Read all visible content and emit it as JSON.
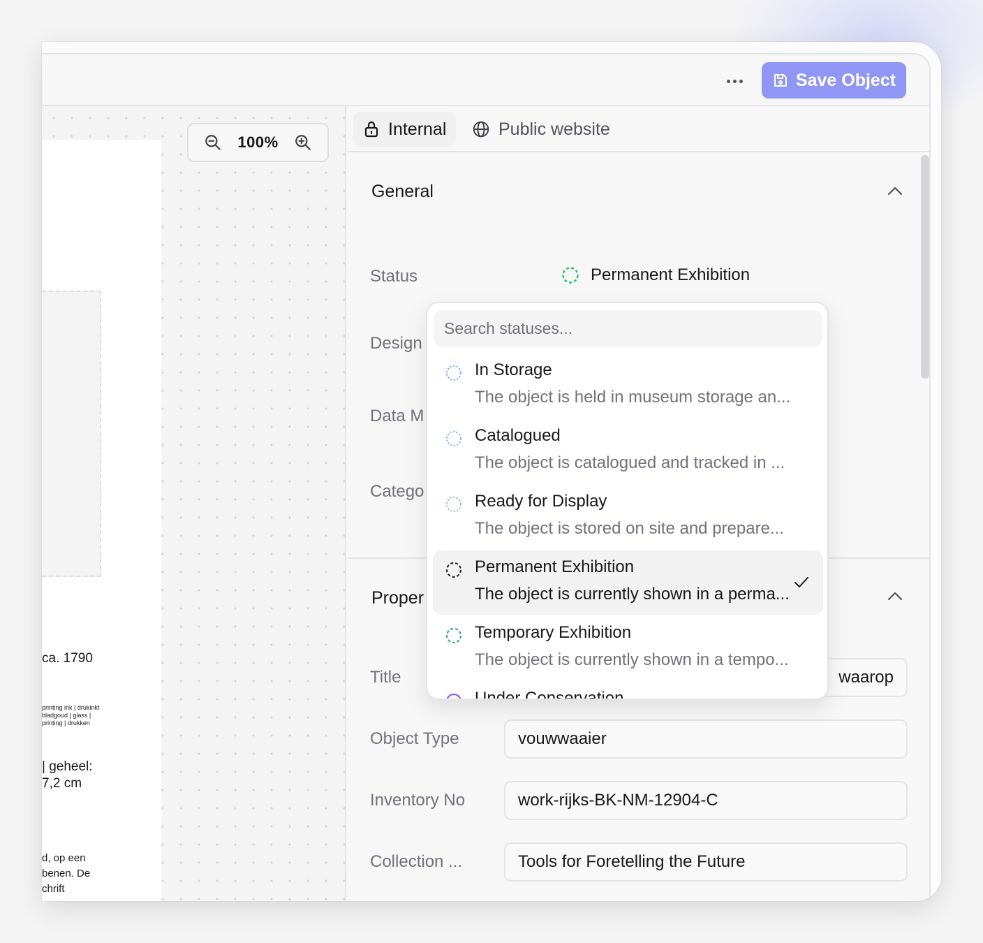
{
  "header": {
    "more_label": "···",
    "save_label": "Save Object",
    "save_color": "#8f96f4"
  },
  "canvas": {
    "zoom_level": "100%",
    "paper_date": "ca. 1790",
    "paper_materials": "printing ink | drukinkt\nbladgoud | glass |\nprinting | drukken",
    "paper_dims": "| geheel:\n7,2 cm",
    "paper_desc": "d, op een\nbenen. De\nchrift"
  },
  "tabs": [
    {
      "label": "Internal",
      "icon": "lock-icon"
    },
    {
      "label": "Public website",
      "icon": "globe-icon"
    }
  ],
  "general": {
    "title": "General",
    "status_label": "Status",
    "status_value": "Permanent Exhibition",
    "design_label": "Design",
    "data_label": "Data M",
    "category_label": "Catego"
  },
  "properties": {
    "title": "Proper",
    "fields": [
      {
        "label": "Title",
        "value": "waarop"
      },
      {
        "label": "Object Type",
        "value": "vouwwaaier"
      },
      {
        "label": "Inventory No",
        "value": "work-rijks-BK-NM-12904-C"
      },
      {
        "label": "Collection ...",
        "value": "Tools for Foretelling the Future"
      }
    ]
  },
  "dropdown": {
    "search_placeholder": "Search statuses...",
    "options": [
      {
        "title": "In Storage",
        "desc": "The object is held in museum storage an...",
        "color": "#60a5fa"
      },
      {
        "title": "Catalogued",
        "desc": "The object is catalogued and tracked in ...",
        "color": "#67b6e8"
      },
      {
        "title": "Ready for Display",
        "desc": "The object is stored on site and prepare...",
        "color": "#7cc9a0"
      },
      {
        "title": "Permanent Exhibition",
        "desc": "The object is currently shown in a perma...",
        "color": "#27272a"
      },
      {
        "title": "Temporary Exhibition",
        "desc": "The object is currently shown in a tempo...",
        "color": "#34a879"
      },
      {
        "title": "Under Conservation",
        "desc": "",
        "color": "#8b5cf6"
      }
    ]
  }
}
